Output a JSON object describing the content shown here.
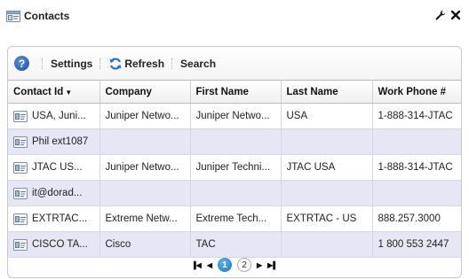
{
  "portlet": {
    "title": "Contacts",
    "tools": [
      "wrench-icon",
      "close-icon"
    ]
  },
  "toolbar": {
    "help_label": "?",
    "settings_label": "Settings",
    "refresh_label": "Refresh",
    "search_label": "Search"
  },
  "table": {
    "columns": [
      "Contact Id",
      "Company",
      "First Name",
      "Last Name",
      "Work Phone #"
    ],
    "rows": [
      [
        "USA, Juni...",
        "Juniper Netwo...",
        "Juniper Netwo...",
        "USA",
        "1-888-314-JTAC"
      ],
      [
        "Phil ext1087",
        "",
        "",
        "",
        ""
      ],
      [
        "JTAC US...",
        "Juniper Netwo...",
        "Juniper Techni...",
        "JTAC USA",
        "1-888-314-JTAC"
      ],
      [
        "it@dorad...",
        "",
        "",
        "",
        ""
      ],
      [
        "EXTRTAC...",
        "Extreme Netw...",
        "Extreme Tech...",
        "EXTRTAC - US",
        "888.257.3000"
      ],
      [
        "CISCO TA...",
        "Cisco",
        "TAC",
        "",
        "1 800 553 2447"
      ]
    ]
  },
  "pager": {
    "pages": [
      "1",
      "2"
    ],
    "current": "1"
  },
  "colors": {
    "alt_row": "#e6e6f5",
    "accent": "#1f76b8"
  }
}
